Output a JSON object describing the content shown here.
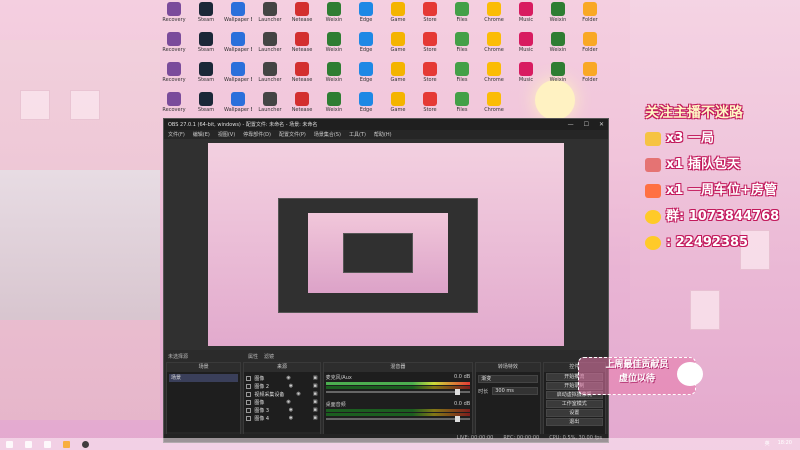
{
  "desktop": {
    "icons": [
      {
        "label": "Recovery",
        "color": "#7a4b9b"
      },
      {
        "label": "Steam",
        "color": "#1b2838"
      },
      {
        "label": "Wallpaper Engine",
        "color": "#2a6fdb"
      },
      {
        "label": "Launcher",
        "color": "#444"
      },
      {
        "label": "Netease",
        "color": "#d32f2f"
      },
      {
        "label": "Weixin",
        "color": "#2e7d32"
      },
      {
        "label": "Edge",
        "color": "#1e88e5"
      },
      {
        "label": "Game",
        "color": "#f4b400"
      },
      {
        "label": "Store",
        "color": "#e53935"
      },
      {
        "label": "Files",
        "color": "#43a047"
      },
      {
        "label": "Chrome",
        "color": "#fbbc05"
      },
      {
        "label": "Music",
        "color": "#d81b60"
      },
      {
        "label": "Weixin",
        "color": "#2e7d32"
      },
      {
        "label": "Folder",
        "color": "#f9a825"
      }
    ]
  },
  "overlay": {
    "title": "关注主播不迷路",
    "lines": [
      {
        "text": "x3 一局",
        "icon_color": "#f6c343"
      },
      {
        "text": "x1 插队包天",
        "icon_color": "#e57373"
      },
      {
        "text": "x1 一周车位+房管",
        "icon_color": "#ff7043"
      },
      {
        "text": "群: 1073844768",
        "icon_color": "#ffca28"
      },
      {
        "text": ": 22492385",
        "icon_color": "#ffca28"
      }
    ]
  },
  "obs": {
    "title": "OBS 27.0.1 (64-bit, windows) - 配置文件: 未命名 - 场景: 未命名",
    "menu": [
      "文件(F)",
      "编辑(E)",
      "视图(V)",
      "停靠部件(D)",
      "配置文件(P)",
      "场景集合(S)",
      "工具(T)",
      "帮助(H)"
    ],
    "toolbar": {
      "no_source": "未选择源",
      "properties": "属性",
      "filters": "滤镜"
    },
    "scenes": {
      "header": "场景",
      "items": [
        "场景"
      ]
    },
    "sources": {
      "header": "来源",
      "items": [
        "图像",
        "图像 2",
        "视频采集设备",
        "图像",
        "图像 3",
        "图像 4"
      ]
    },
    "mixer": {
      "header": "混音器",
      "channels": [
        {
          "name": "麦克风/Aux",
          "db": "0.0 dB"
        },
        {
          "name": "桌面音频",
          "db": "0.0 dB"
        }
      ]
    },
    "transitions": {
      "header": "转场特效",
      "type": "渐变",
      "duration_label": "时长",
      "duration": "300 ms"
    },
    "controls": {
      "header": "控件",
      "buttons": [
        "开始推流",
        "开始录制",
        "启动虚拟摄像机",
        "工作室模式",
        "设置",
        "退出"
      ]
    },
    "status": {
      "live": "LIVE: 00:00:00",
      "rec": "REC: 00:00:00",
      "cpu": "CPU: 0.5%, 30.00 fps"
    },
    "footer_symbols": "+ − ∧ ∨"
  },
  "gift": {
    "line1": "上周最佳贡献员",
    "line2": "虚位以待"
  },
  "taskbar": {
    "tray": [
      "英",
      "18:20"
    ]
  }
}
